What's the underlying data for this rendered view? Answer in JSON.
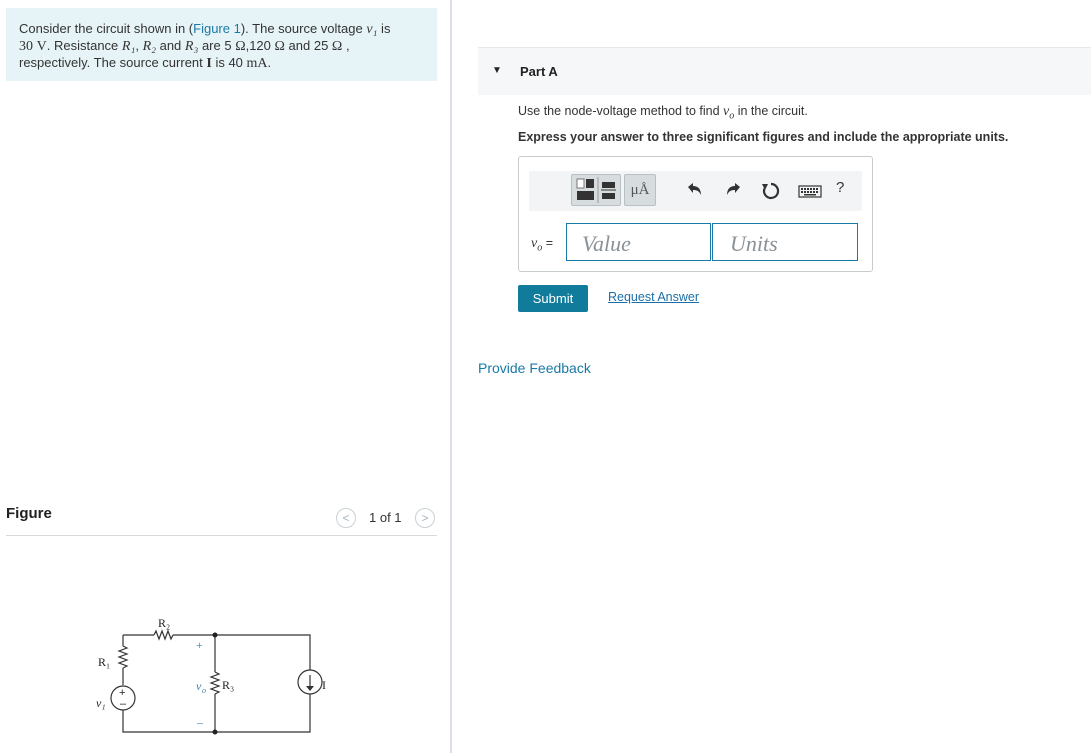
{
  "problem": {
    "t1": "Consider the circuit shown in (",
    "figure_link": "Figure 1",
    "t2": "). The source voltage ",
    "v1": "v₁",
    "t3": " is",
    "v1_value": "30",
    "v1_unit": "V",
    "t4": ". Resistance ",
    "r1": "R₁",
    "t5": ", ",
    "r2": "R₂",
    "t6": " and ",
    "r3": "R₃",
    "t7": " are 5 ",
    "ohm": "Ω",
    "t8": ",120 ",
    "t9": " and 25 ",
    "t10": " ,",
    "t11": "respectively. The source current ",
    "current_sym": "I",
    "t12": " is 40 ",
    "current_unit": "mA",
    "t13": "."
  },
  "figure": {
    "title": "Figure",
    "prev": "<",
    "next": ">",
    "pager": "1 of 1",
    "labels": {
      "R1": "R₁",
      "R2": "R₂",
      "R3": "R₃",
      "V1": "v₁",
      "Vo": "v",
      "Vo_sub": "o",
      "I": "I",
      "plus": "+",
      "minus": "–"
    }
  },
  "part": {
    "caret": "▼",
    "title": "Part A",
    "instruction_pre": "Use the node-voltage method to find ",
    "instruction_var": "v",
    "instruction_sub": "o",
    "instruction_post": " in the circuit.",
    "express": "Express your answer to three significant figures and include the appropriate units."
  },
  "toolbar": {
    "units_label": "μÅ",
    "help_label": "?"
  },
  "answer": {
    "var": "v",
    "var_sub": "o",
    "equals": " =",
    "value_placeholder": "Value",
    "units_placeholder": "Units"
  },
  "actions": {
    "submit_label": "Submit",
    "request_label": "Request Answer",
    "feedback_label": "Provide Feedback"
  },
  "colors": {
    "accent": "#117b9b",
    "link": "#1a7aa6",
    "problem_bg": "#e7f4f7"
  }
}
